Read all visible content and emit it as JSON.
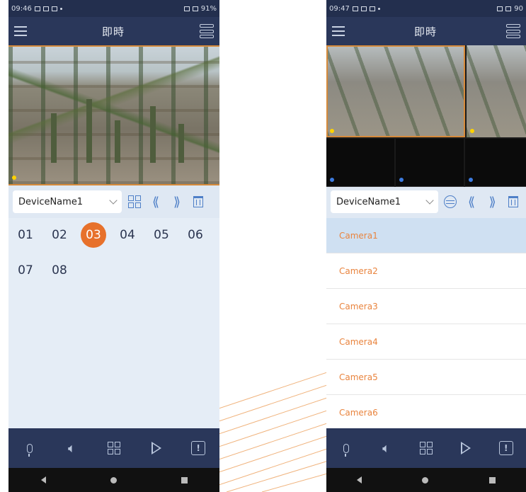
{
  "left_screen": {
    "status": {
      "time": "09:46",
      "battery": "91%"
    },
    "title": "即時",
    "device_name": "DeviceName1",
    "channels": [
      "01",
      "02",
      "03",
      "04",
      "05",
      "06",
      "07",
      "08"
    ],
    "active_channel": "03"
  },
  "right_screen": {
    "status": {
      "time": "09:47",
      "battery": "90"
    },
    "title": "即時",
    "device_name": "DeviceName1",
    "cameras": [
      "Camera1",
      "Camera2",
      "Camera3",
      "Camera4",
      "Camera5",
      "Camera6"
    ],
    "selected_camera": "Camera1"
  },
  "colors": {
    "accent": "#e7712b",
    "header": "#2a375a",
    "icon_blue": "#4e7fc7",
    "list_text": "#e9843e"
  }
}
